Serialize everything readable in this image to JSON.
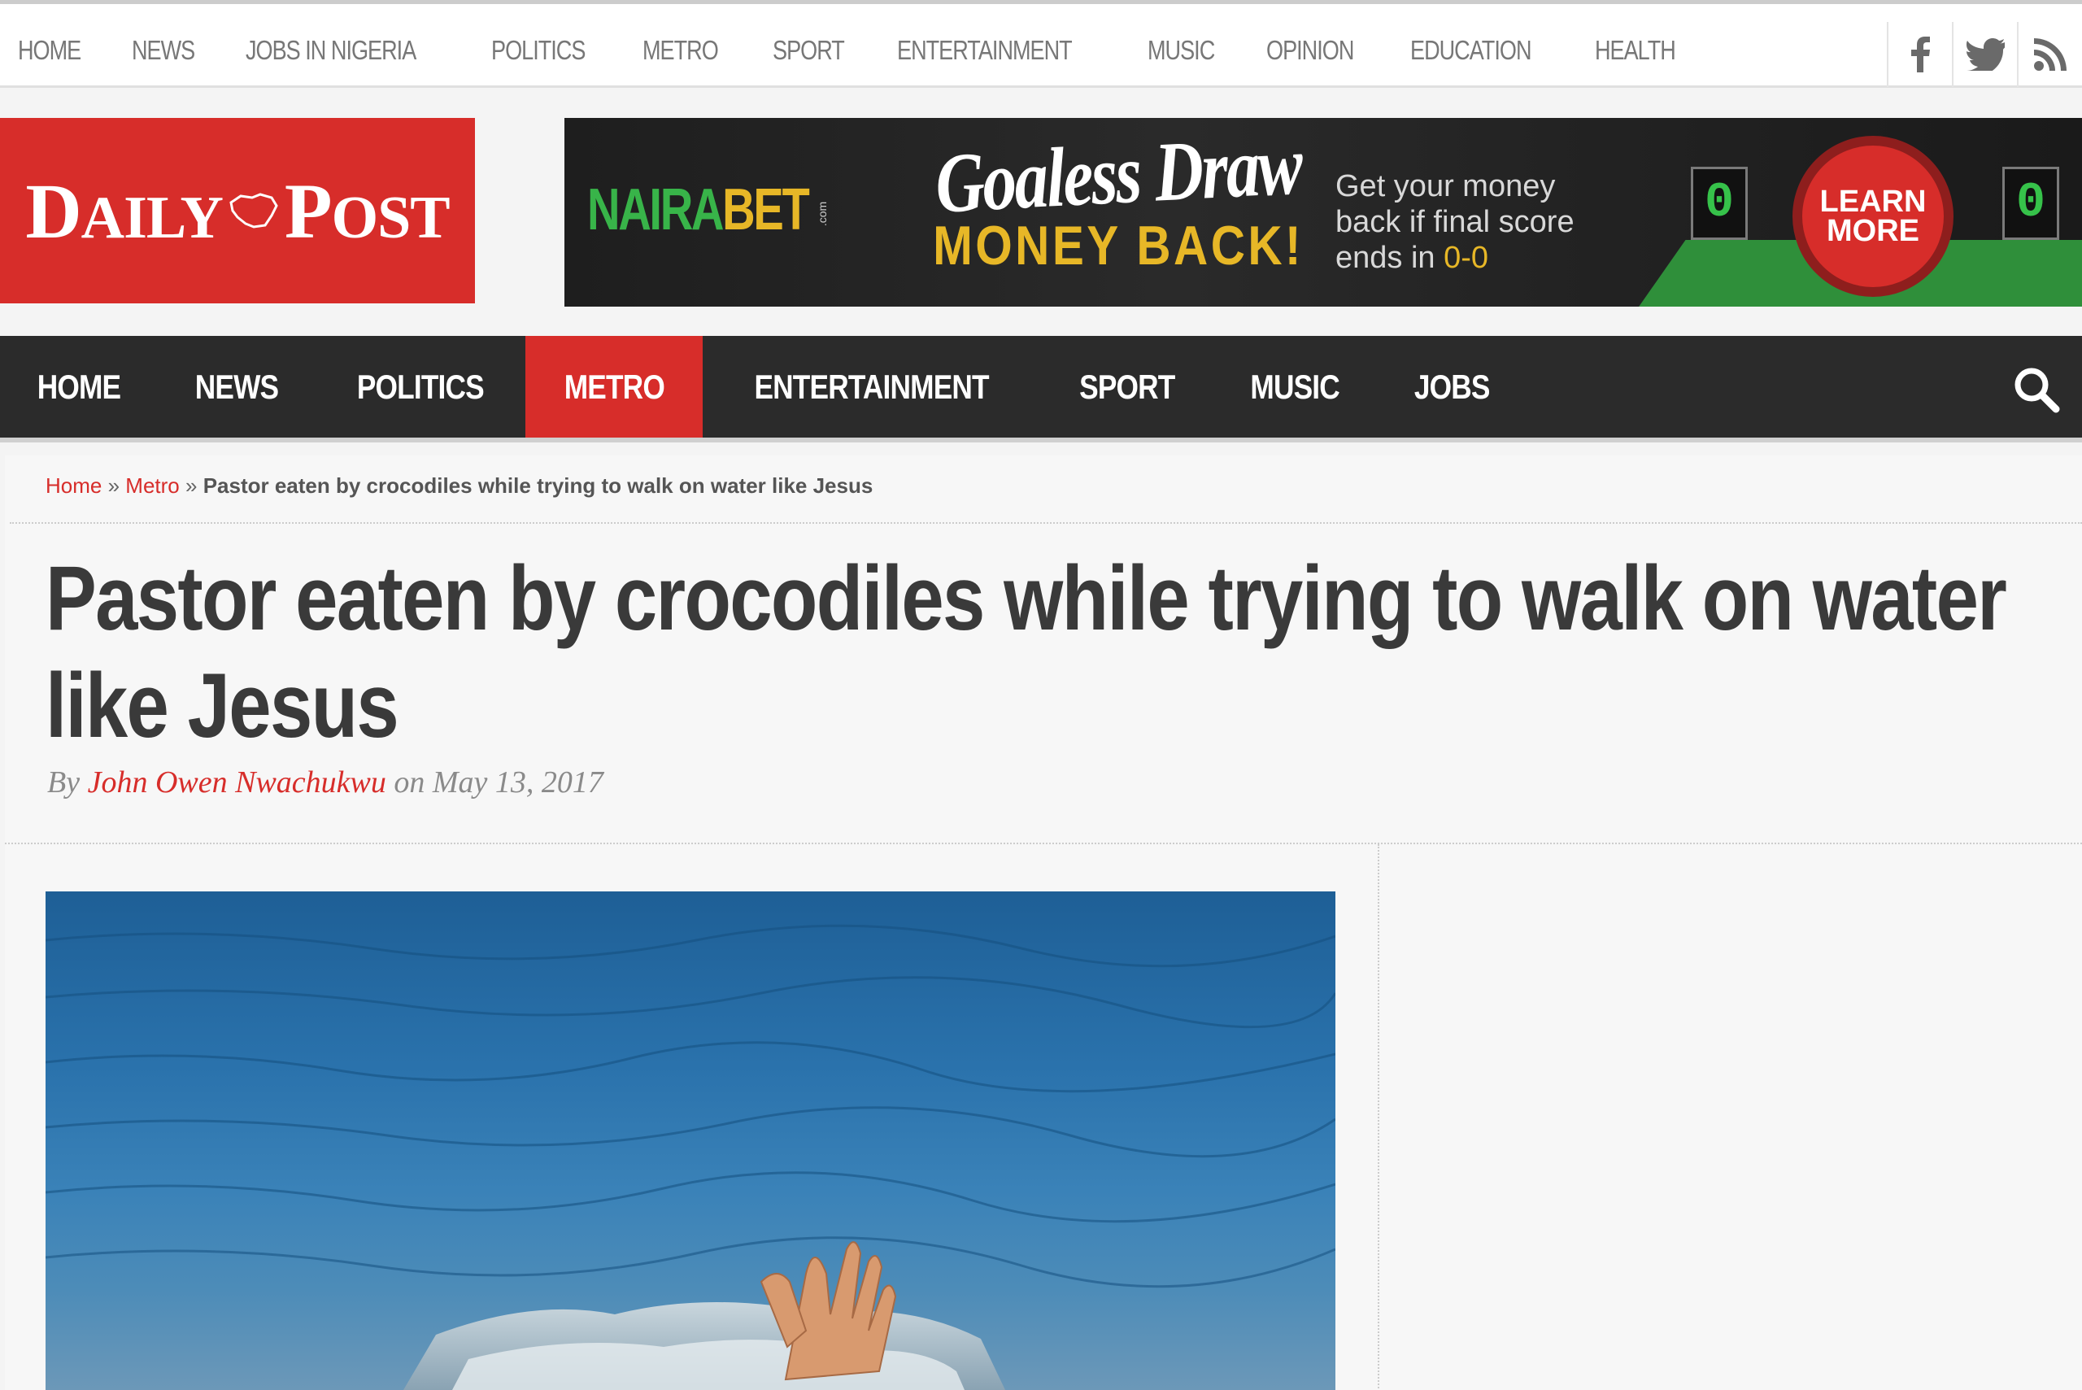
{
  "topnav": {
    "items": [
      "HOME",
      "NEWS",
      "JOBS IN NIGERIA",
      "POLITICS",
      "METRO",
      "SPORT",
      "ENTERTAINMENT",
      "MUSIC",
      "OPINION",
      "EDUCATION",
      "HEALTH"
    ],
    "social": [
      "facebook-icon",
      "twitter-icon",
      "rss-icon"
    ]
  },
  "logo": {
    "part1": "Daily",
    "part2": "Post"
  },
  "ad": {
    "brand_green": "NAIRA",
    "brand_yellow": "BET",
    "brand_suffix": ".com",
    "headline": "Goaless Draw",
    "subheadline": "MONEY BACK!",
    "copy_line1": "Get your money",
    "copy_line2": "back if final score",
    "copy_line3_prefix": "ends in ",
    "copy_line3_highlight": "0-0",
    "score_left": "0",
    "score_right": "0",
    "cta": "LEARN MORE"
  },
  "mainnav": {
    "items": [
      "HOME",
      "NEWS",
      "POLITICS",
      "METRO",
      "ENTERTAINMENT",
      "SPORT",
      "MUSIC",
      "JOBS"
    ],
    "active": "METRO"
  },
  "breadcrumb": {
    "home": "Home",
    "sep": "»",
    "section": "Metro",
    "current": "Pastor eaten by crocodiles while trying to walk on water like Jesus"
  },
  "article": {
    "title": "Pastor eaten by crocodiles while trying to walk on water like Jesus",
    "by_prefix": "By",
    "author": "John Owen Nwachukwu",
    "date_prefix": "on",
    "date": "May 13, 2017"
  },
  "colors": {
    "brand_red": "#d72d2a",
    "nav_dark": "#2b2b2b",
    "ad_green": "#38b449",
    "ad_yellow": "#e7b727"
  }
}
